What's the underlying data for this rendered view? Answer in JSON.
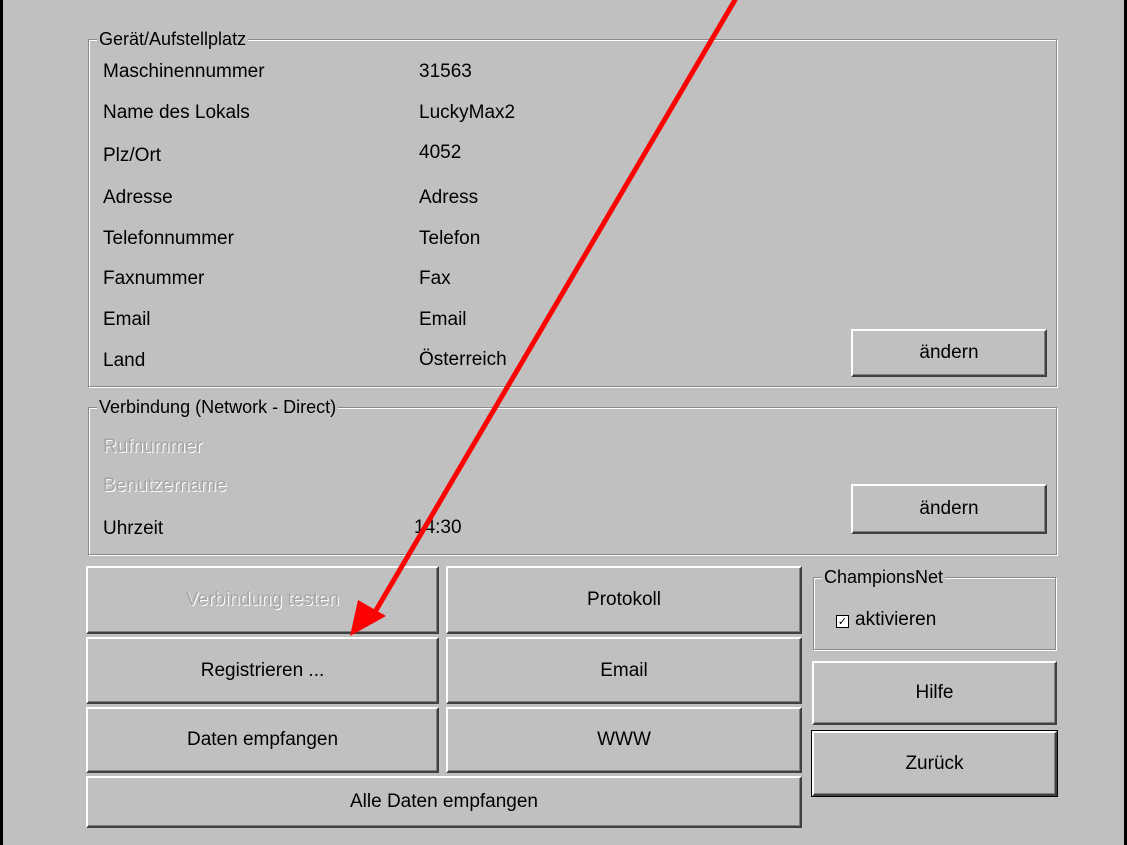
{
  "device": {
    "legend": "Gerät/Aufstellplatz",
    "rows": [
      {
        "label": "Maschinennummer",
        "value": "31563"
      },
      {
        "label": "Name des Lokals",
        "value": "LuckyMax2"
      },
      {
        "label": "Plz/Ort",
        "value": "4052"
      },
      {
        "label": "Adresse",
        "value": "Adress"
      },
      {
        "label": "Telefonnummer",
        "value": "Telefon"
      },
      {
        "label": "Faxnummer",
        "value": "Fax"
      },
      {
        "label": "Email",
        "value": "Email"
      },
      {
        "label": "Land",
        "value": "Österreich"
      }
    ],
    "change_label": "ändern"
  },
  "connection": {
    "legend": "Verbindung (Network - Direct)",
    "phone_label": "Rufnummer",
    "user_label": "Benutzername",
    "time_label": "Uhrzeit",
    "time_value": "14:30",
    "change_label": "ändern"
  },
  "actions": {
    "test_connection": "Verbindung testen",
    "protocol": "Protokoll",
    "register": "Registrieren ...",
    "email": "Email",
    "receive_data": "Daten empfangen",
    "www": "WWW",
    "receive_all": "Alle Daten empfangen"
  },
  "championsnet": {
    "legend": "ChampionsNet",
    "checkbox_label": "aktivieren",
    "checked": true
  },
  "side_buttons": {
    "help": "Hilfe",
    "back": "Zurück"
  },
  "annotation": {
    "arrow_color": "#ff0000"
  },
  "colors": {
    "background": "#c0c0c0",
    "disabled_text": "#a6a6a6"
  }
}
